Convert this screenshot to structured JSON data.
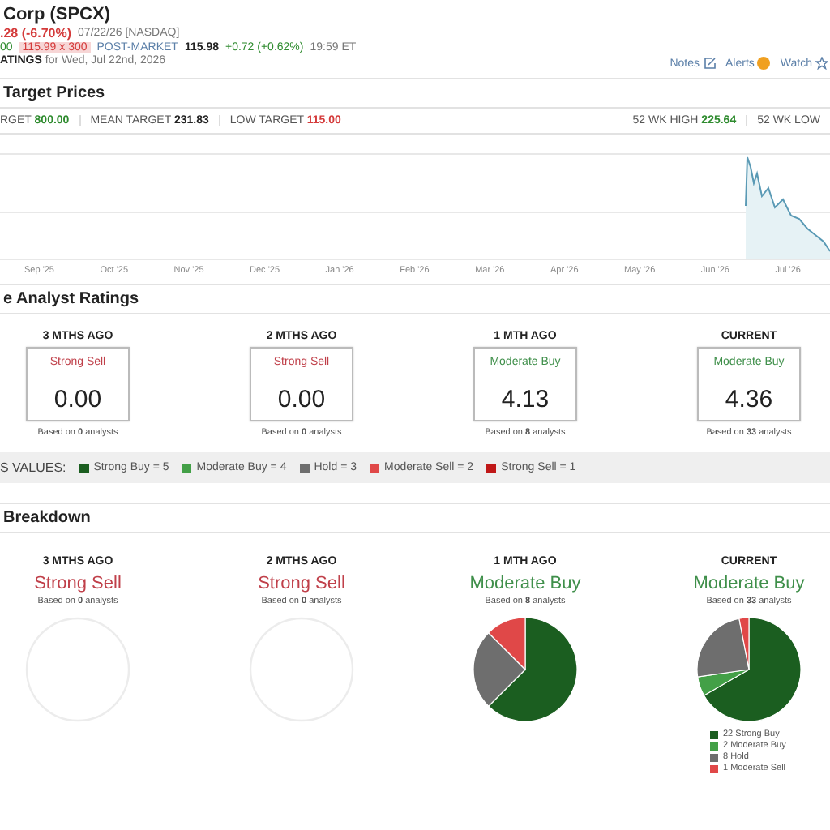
{
  "header": {
    "title": "Corp (SPCX)",
    "change": ".28 (-6.70%)",
    "date": "07/22/26 [NASDAQ]",
    "price_tail": "00",
    "quote": "115.99 x 300",
    "post_label": "POST-MARKET",
    "post_price": "115.98",
    "post_change": "+0.72 (+0.62%)",
    "post_time": "19:59 ET",
    "ratings_label": "ATINGS",
    "ratings_date": "for Wed, Jul 22nd, 2026",
    "actions": [
      {
        "label": "Notes",
        "kind": "notes"
      },
      {
        "label": "Alerts",
        "kind": "alerts"
      },
      {
        "label": "Watch",
        "kind": "watch"
      }
    ]
  },
  "target_prices": {
    "title": "Target Prices",
    "stats": [
      {
        "label": "RGET",
        "value": "800.00",
        "color": "#2e8b2e"
      },
      {
        "label": "MEAN TARGET",
        "value": "231.83",
        "color": "#222222"
      },
      {
        "label": "LOW TARGET",
        "value": "115.00",
        "color": "#d43a3a"
      }
    ],
    "range_stats": [
      {
        "label": "52 WK HIGH",
        "value": "225.64",
        "color": "#2e8b2e"
      },
      {
        "label": "52 WK LOW"
      }
    ],
    "x_labels": [
      "Sep '25",
      "Oct '25",
      "Nov '25",
      "Dec '25",
      "Jan '26",
      "Feb '26",
      "Mar '26",
      "Apr '26",
      "May '26",
      "Jun '26",
      "Jul '26"
    ]
  },
  "ratings": {
    "title": "e Analyst Ratings",
    "periods": [
      {
        "period": "3 MTHS AGO",
        "rating": "Strong Sell",
        "color": "#c0404a",
        "score": "0.00",
        "basis": "Based on **0** analysts"
      },
      {
        "period": "2 MTHS AGO",
        "rating": "Strong Sell",
        "color": "#c0404a",
        "score": "0.00",
        "basis": "Based on **0** analysts"
      },
      {
        "period": "1 MTH AGO",
        "rating": "Moderate Buy",
        "color": "#3f8f4a",
        "score": "4.13",
        "basis": "Based on **8** analysts"
      },
      {
        "period": "CURRENT",
        "rating": "Moderate Buy",
        "color": "#3f8f4a",
        "score": "4.36",
        "basis": "Based on **33** analysts"
      }
    ]
  },
  "values_legend": {
    "label": "S VALUES:",
    "items": [
      {
        "label": "Strong Buy = 5",
        "color": "#1b5e20"
      },
      {
        "label": "Moderate Buy = 4",
        "color": "#43a047"
      },
      {
        "label": "Hold = 3",
        "color": "#6e6e6e"
      },
      {
        "label": "Moderate Sell = 2",
        "color": "#e04848"
      },
      {
        "label": "Strong Sell = 1",
        "color": "#c01818"
      }
    ]
  },
  "breakdown": {
    "title": "Breakdown",
    "periods": [
      {
        "period": "3 MTHS AGO",
        "rating": "Strong Sell",
        "color": "#c0404a",
        "basis": "Based on **0** analysts"
      },
      {
        "period": "2 MTHS AGO",
        "rating": "Strong Sell",
        "color": "#c0404a",
        "basis": "Based on **0** analysts"
      },
      {
        "period": "1 MTH AGO",
        "rating": "Moderate Buy",
        "color": "#3f8f4a",
        "basis": "Based on **8** analysts",
        "chart_data": {
          "type": "pie",
          "series": [
            {
              "values": [
                62.5,
                0,
                25,
                12.5
              ]
            }
          ]
        }
      },
      {
        "period": "CURRENT",
        "rating": "Moderate Buy",
        "color": "#3f8f4a",
        "basis": "Based on **33** analysts",
        "chart_data": {
          "type": "pie",
          "categories": [
            "22 Strong Buy",
            "2 Moderate Buy",
            "8 Hold",
            "1 Moderate Sell"
          ],
          "series": [
            {
              "values": [
                66.67,
                6.06,
                24.24,
                3.03
              ]
            }
          ]
        }
      }
    ]
  }
}
